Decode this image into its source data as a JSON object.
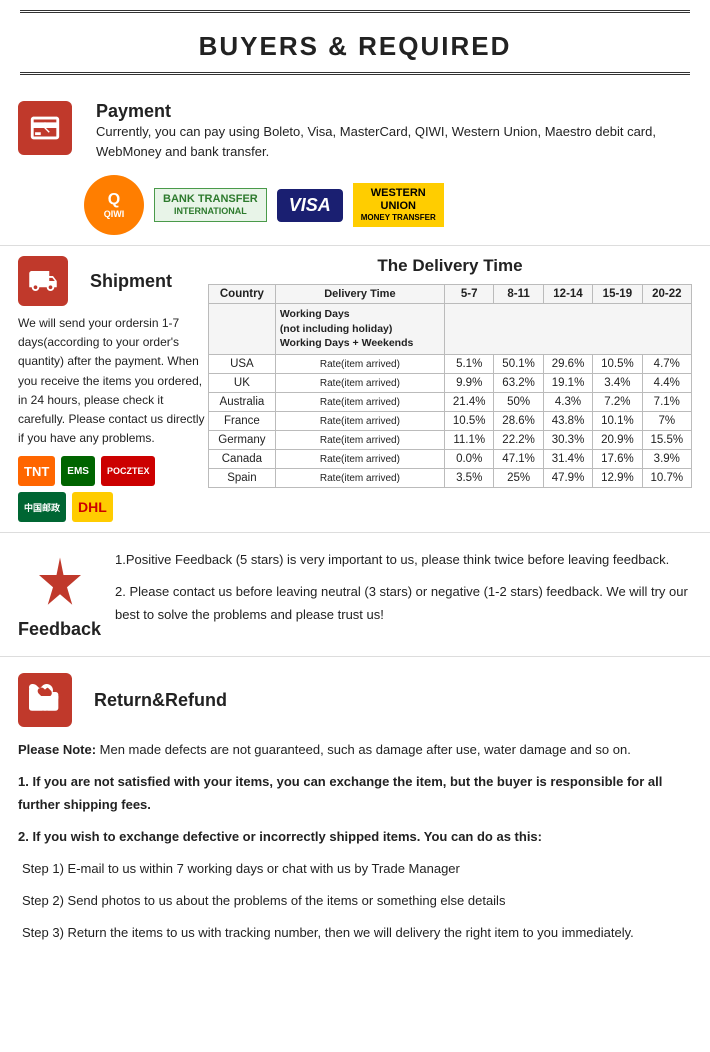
{
  "header": {
    "title": "BUYERS & REQUIRED"
  },
  "payment": {
    "section_title": "Payment",
    "description": "Currently, you can pay using Boleto, Visa, MasterCard, QIWI, Western Union, Maestro  debit card, WebMoney and bank transfer.",
    "logos": [
      {
        "name": "QIWI",
        "type": "qiwi"
      },
      {
        "name": "BANK TRANSFER\nINTERNATIONAL",
        "type": "bank-transfer"
      },
      {
        "name": "VISA",
        "type": "visa"
      },
      {
        "name": "WESTERN\nUNION\nMONEY TRANSFER",
        "type": "western-union"
      }
    ]
  },
  "shipment": {
    "section_title": "Shipment",
    "delivery_title": "The Delivery Time",
    "description": "We will send your ordersin 1-7 days(according to your order's quantity) after the payment. When you receive the items you ordered, in 24  hours, please check it carefully. Please  contact us directly if you have any problems.",
    "table": {
      "headers": [
        "Country",
        "",
        "5-7",
        "8-11",
        "12-14",
        "15-19",
        "20-22"
      ],
      "working_days_label": "Working Days\n(not including holiday)\nWorking Days + Weekends",
      "rows": [
        {
          "country": "USA",
          "rate_label": "Rate(item arrived)",
          "col1": "5.1%",
          "col2": "50.1%",
          "col3": "29.6%",
          "col4": "10.5%",
          "col5": "4.7%"
        },
        {
          "country": "UK",
          "rate_label": "Rate(item arrived)",
          "col1": "9.9%",
          "col2": "63.2%",
          "col3": "19.1%",
          "col4": "3.4%",
          "col5": "4.4%"
        },
        {
          "country": "Australia",
          "rate_label": "Rate(item arrived)",
          "col1": "21.4%",
          "col2": "50%",
          "col3": "4.3%",
          "col4": "7.2%",
          "col5": "7.1%"
        },
        {
          "country": "France",
          "rate_label": "Rate(item arrived)",
          "col1": "10.5%",
          "col2": "28.6%",
          "col3": "43.8%",
          "col4": "10.1%",
          "col5": "7%"
        },
        {
          "country": "Germany",
          "rate_label": "Rate(item arrived)",
          "col1": "11.1%",
          "col2": "22.2%",
          "col3": "30.3%",
          "col4": "20.9%",
          "col5": "15.5%"
        },
        {
          "country": "Canada",
          "rate_label": "Rate(item arrived)",
          "col1": "0.0%",
          "col2": "47.1%",
          "col3": "31.4%",
          "col4": "17.6%",
          "col5": "3.9%"
        },
        {
          "country": "Spain",
          "rate_label": "Rate(item arrived)",
          "col1": "3.5%",
          "col2": "25%",
          "col3": "47.9%",
          "col4": "12.9%",
          "col5": "10.7%"
        }
      ]
    },
    "carriers": [
      "TNT",
      "EMS",
      "POCZTEX",
      "中国邮政",
      "DHL"
    ]
  },
  "feedback": {
    "section_title": "Feedback",
    "text1": "1.Positive Feedback (5 stars) is very important to us, please think twice before leaving feedback.",
    "text2": "2. Please contact us before leaving neutral (3 stars) or negative  (1-2 stars) feedback. We will try our best to solve the problems and please trust us!"
  },
  "return_refund": {
    "section_title": "Return&Refund",
    "note_label": "Please Note:",
    "note_text": " Men made defects are not guaranteed, such as damage after use, water damage and so on.",
    "point1": "1. If you are not satisfied with your items, you can exchange the item, but the buyer is responsible for all further shipping fees.",
    "point2_label": "2. If you wish to exchange defective or incorrectly shipped items. You can do as this:",
    "step1": "Step 1) E-mail to us within 7 working days or chat with us by Trade Manager",
    "step2": "Step 2) Send photos to us about the problems of the items or something else details",
    "step3": "Step 3) Return the items to us with tracking number, then we will delivery the right item to you immediately."
  }
}
